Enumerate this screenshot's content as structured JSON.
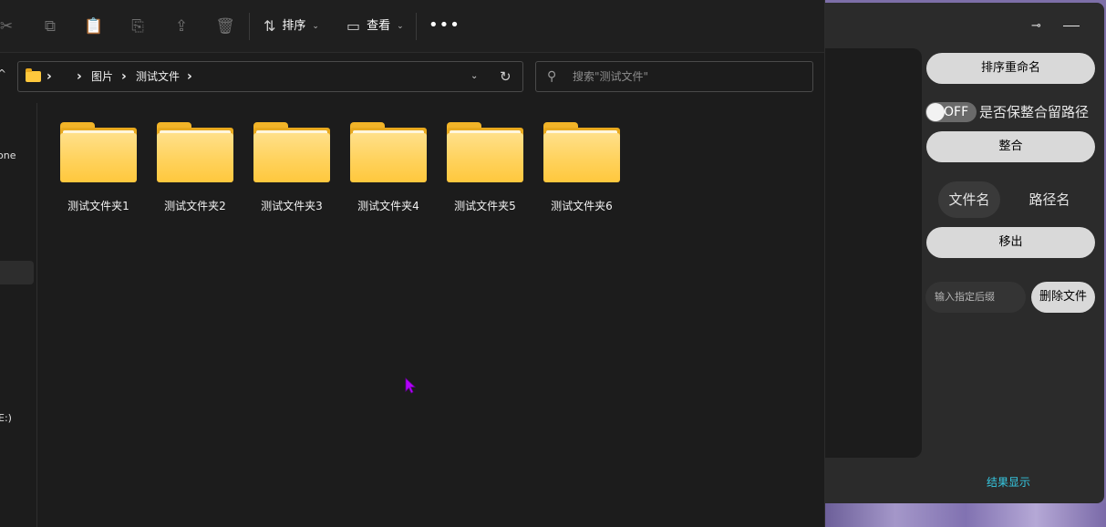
{
  "toolbar": {
    "sort_label": "排序",
    "view_label": "查看",
    "more_label": "•••"
  },
  "address": {
    "crumbs": [
      "图片",
      "测试文件"
    ]
  },
  "search": {
    "placeholder": "搜索\"测试文件\""
  },
  "nav": {
    "onedrive_fragment": "one",
    "drive_fragment": "E:)"
  },
  "files": [
    {
      "name": "测试文件夹1"
    },
    {
      "name": "测试文件夹2"
    },
    {
      "name": "测试文件夹3"
    },
    {
      "name": "测试文件夹4"
    },
    {
      "name": "测试文件夹5"
    },
    {
      "name": "测试文件夹6"
    }
  ],
  "tool": {
    "sort_rename": "排序重命名",
    "toggle_state": "OFF",
    "keep_path_label": "是否保整合留路径",
    "merge": "整合",
    "tab_filename": "文件名",
    "tab_pathname": "路径名",
    "move_out": "移出",
    "suffix_placeholder": "输入指定后缀",
    "delete_files": "删除文件",
    "result_display": "结果显示"
  },
  "colors": {
    "folder": "#ffc83d",
    "accent_text": "#36c7e0",
    "cursor": "#b400ff"
  }
}
